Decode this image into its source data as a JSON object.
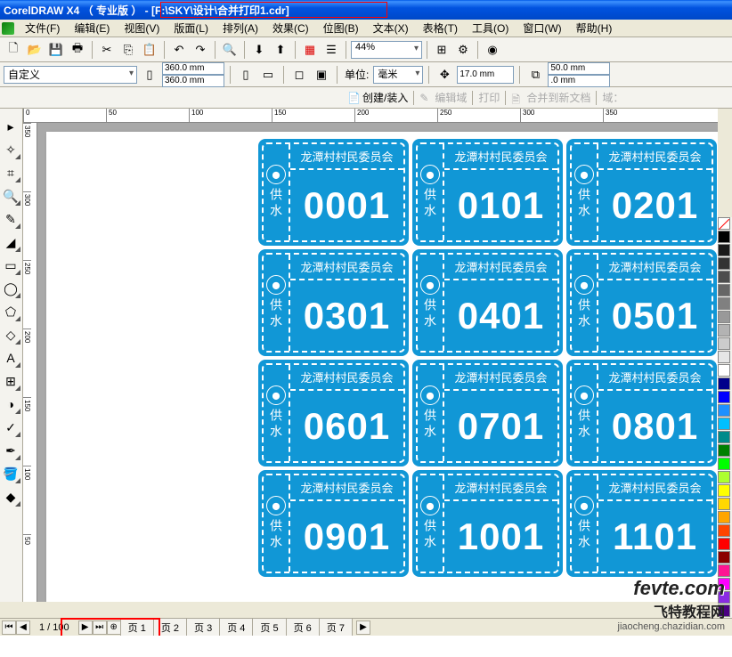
{
  "window": {
    "title": "CorelDRAW X4 （ 专业版 ） - [F:\\SKY\\设计\\合并打印1.cdr]"
  },
  "menu": {
    "items": [
      "文件(F)",
      "编辑(E)",
      "视图(V)",
      "版面(L)",
      "排列(A)",
      "效果(C)",
      "位图(B)",
      "文本(X)",
      "表格(T)",
      "工具(O)",
      "窗口(W)",
      "帮助(H)"
    ]
  },
  "toolbar": {
    "zoom_value": "44%"
  },
  "propbar": {
    "paper": "自定义",
    "width": "360.0 mm",
    "height": "360.0 mm",
    "units_label": "单位:",
    "units": "毫米",
    "nudge": "17.0 mm",
    "dup_x": "50.0 mm",
    "dup_y": ".0 mm"
  },
  "auxbar": {
    "create": "创建/装入",
    "edit_region": "编辑域",
    "print": "打印",
    "merge_new": "合并到新文档",
    "region_label": "域："
  },
  "ruler_h": [
    "0",
    "50",
    "100",
    "150",
    "200",
    "250",
    "300",
    "350"
  ],
  "ruler_v": [
    "350",
    "300",
    "250",
    "200",
    "150",
    "100",
    "50"
  ],
  "tickets": {
    "header": "龙潭村村民委员会",
    "side": "供水",
    "numbers": [
      "0001",
      "0101",
      "0201",
      "0301",
      "0401",
      "0501",
      "0601",
      "0701",
      "0801",
      "0901",
      "1001",
      "1101"
    ]
  },
  "palette": [
    "#000000",
    "#1a1a1a",
    "#333333",
    "#4d4d4d",
    "#666666",
    "#808080",
    "#999999",
    "#b3b3b3",
    "#cccccc",
    "#e6e6e6",
    "#ffffff",
    "#00008b",
    "#0000ff",
    "#1e90ff",
    "#00bfff",
    "#008b8b",
    "#008000",
    "#00ff00",
    "#adff2f",
    "#ffff00",
    "#ffd700",
    "#ffa500",
    "#ff4500",
    "#ff0000",
    "#8b0000",
    "#ff1493",
    "#ff00ff",
    "#8a2be2",
    "#4b0082",
    "#a52a2a",
    "#f5deb3"
  ],
  "status": {
    "page_current": "1",
    "page_total": "100",
    "page_display": "1 / 100",
    "tabs": [
      "页 1",
      "页 2",
      "页 3",
      "页 4",
      "页 5",
      "页 6",
      "页 7"
    ]
  },
  "watermark": {
    "line1": "fevte.com",
    "line2": "飞特教程网",
    "line3": "jiaocheng.chazidian.com"
  }
}
